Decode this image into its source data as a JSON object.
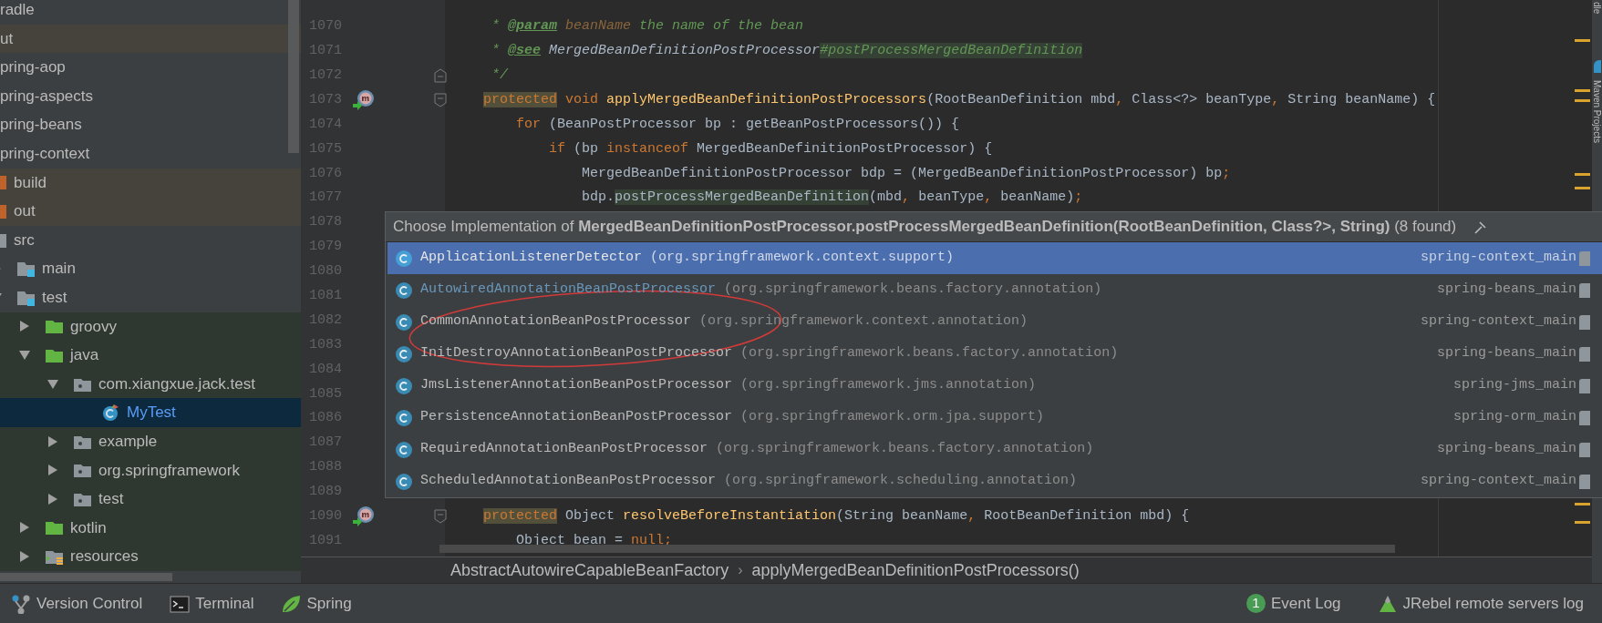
{
  "project_tree": [
    {
      "label": "radle",
      "kind": "module",
      "selected": false
    },
    {
      "label": "ut",
      "kind": "excluded",
      "selected": false
    },
    {
      "label": "pring-aop",
      "kind": "module",
      "selected": false
    },
    {
      "label": "pring-aspects",
      "kind": "module",
      "selected": false
    },
    {
      "label": "pring-beans",
      "kind": "module",
      "selected": false
    },
    {
      "label": "pring-context",
      "kind": "module",
      "selected": false,
      "children": [
        {
          "label": "build",
          "kind": "excluded",
          "selected": false
        },
        {
          "label": "out",
          "kind": "excluded",
          "selected": false
        },
        {
          "label": "src",
          "kind": "folder",
          "selected": false,
          "children": [
            {
              "label": "main",
              "kind": "module-folder",
              "expanded": false,
              "selected": false
            },
            {
              "label": "test",
              "kind": "module-folder",
              "expanded": true,
              "selected": false,
              "children": [
                {
                  "label": "groovy",
                  "kind": "test-source",
                  "expanded": false,
                  "selected": false
                },
                {
                  "label": "java",
                  "kind": "test-source",
                  "expanded": true,
                  "selected": false,
                  "children": [
                    {
                      "label": "com.xiangxue.jack.test",
                      "kind": "package",
                      "expanded": true,
                      "selected": false,
                      "children": [
                        {
                          "label": "MyTest",
                          "kind": "class",
                          "selected": true
                        }
                      ]
                    },
                    {
                      "label": "example",
                      "kind": "package",
                      "expanded": false,
                      "selected": false
                    },
                    {
                      "label": "org.springframework",
                      "kind": "package",
                      "expanded": false,
                      "selected": false
                    },
                    {
                      "label": "test",
                      "kind": "package",
                      "expanded": false,
                      "selected": false
                    }
                  ]
                },
                {
                  "label": "kotlin",
                  "kind": "test-source",
                  "expanded": false,
                  "selected": false
                },
                {
                  "label": "resources",
                  "kind": "test-resources",
                  "expanded": false,
                  "selected": false
                }
              ]
            }
          ]
        }
      ]
    }
  ],
  "editor": {
    "lines": [
      {
        "number": "1070",
        "tokens": [
          {
            "t": "     * ",
            "kind": "doc"
          },
          {
            "t": "@param",
            "kind": "doctag"
          },
          {
            "t": " beanName",
            "kind": "docparam"
          },
          {
            "t": " the name of the bean",
            "kind": "doc"
          }
        ]
      },
      {
        "number": "1071",
        "tokens": [
          {
            "t": "     * ",
            "kind": "doc"
          },
          {
            "t": "@see",
            "kind": "doctag"
          },
          {
            "t": " MergedBeanDefinitionPostProcessor",
            "kind": "docref"
          },
          {
            "t": "#postProcessMergedBeanDefinition",
            "kind": "doc-hl"
          }
        ]
      },
      {
        "number": "1072",
        "kind": "comment-end",
        "tokens": [
          {
            "t": "     */",
            "kind": "doc"
          }
        ]
      },
      {
        "number": "1073",
        "kind": "method-start",
        "tokens": [
          {
            "t": "    protected",
            "kind": "keyword-hl"
          },
          {
            "t": " void ",
            "kind": "keyword"
          },
          {
            "t": "applyMergedBeanDefinitionPostProcessors",
            "kind": "method"
          },
          {
            "t": "(RootBeanDefinition mbd",
            "kind": "plain"
          },
          {
            "t": ", ",
            "kind": "keyword"
          },
          {
            "t": "Class<?> beanType",
            "kind": "plain"
          },
          {
            "t": ", ",
            "kind": "keyword"
          },
          {
            "t": "String beanName) {",
            "kind": "plain"
          }
        ]
      },
      {
        "number": "1074",
        "tokens": [
          {
            "t": "        for ",
            "kind": "keyword"
          },
          {
            "t": "(BeanPostProcessor bp : getBeanPostProcessors()) {",
            "kind": "plain"
          }
        ]
      },
      {
        "number": "1075",
        "tokens": [
          {
            "t": "            if ",
            "kind": "keyword"
          },
          {
            "t": "(bp ",
            "kind": "plain"
          },
          {
            "t": "instanceof ",
            "kind": "keyword"
          },
          {
            "t": "MergedBeanDefinitionPostProcessor) {",
            "kind": "plain"
          }
        ]
      },
      {
        "number": "1076",
        "tokens": [
          {
            "t": "                MergedBeanDefinitionPostProcessor bdp = (MergedBeanDefinitionPostProcessor) bp",
            "kind": "plain"
          },
          {
            "t": ";",
            "kind": "keyword"
          }
        ]
      },
      {
        "number": "1077",
        "tokens": [
          {
            "t": "                bdp.",
            "kind": "plain"
          },
          {
            "t": "postProcessMergedBeanDefinition",
            "kind": "plain-hl"
          },
          {
            "t": "(mbd",
            "kind": "plain"
          },
          {
            "t": ", ",
            "kind": "keyword"
          },
          {
            "t": "beanType",
            "kind": "plain"
          },
          {
            "t": ", ",
            "kind": "keyword"
          },
          {
            "t": "beanName)",
            "kind": "plain"
          },
          {
            "t": ";",
            "kind": "keyword"
          }
        ]
      },
      {
        "number": "1078"
      },
      {
        "number": "1079"
      },
      {
        "number": "1080"
      },
      {
        "number": "1081"
      },
      {
        "number": "1082"
      },
      {
        "number": "1083"
      },
      {
        "number": "1084"
      },
      {
        "number": "1085"
      },
      {
        "number": "1086"
      },
      {
        "number": "1087"
      },
      {
        "number": "1088"
      },
      {
        "number": "1089"
      },
      {
        "number": "1090",
        "kind": "method-start",
        "tokens": [
          {
            "t": "    protected",
            "kind": "keyword-hl"
          },
          {
            "t": " Object ",
            "kind": "plain"
          },
          {
            "t": "resolveBeforeInstantiation",
            "kind": "method"
          },
          {
            "t": "(String beanName",
            "kind": "plain"
          },
          {
            "t": ", ",
            "kind": "keyword"
          },
          {
            "t": "RootBeanDefinition mbd) {",
            "kind": "plain"
          }
        ]
      },
      {
        "number": "1091",
        "tokens": [
          {
            "t": "        Object bean = ",
            "kind": "plain"
          },
          {
            "t": "null",
            "kind": "keyword"
          },
          {
            "t": ";",
            "kind": "keyword"
          }
        ]
      }
    ]
  },
  "breadcrumbs": [
    {
      "label": "AbstractAutowireCapableBeanFactory",
      "kind": "crumb"
    },
    {
      "label": "›",
      "kind": "separator"
    },
    {
      "label": "applyMergedBeanDefinitionPostProcessors()",
      "kind": "crumb"
    }
  ],
  "right_strip": [
    {
      "label": "dle"
    },
    {
      "label": "Maven Projects"
    }
  ],
  "popup": {
    "title": "Choose Implementation of **MergedBeanDefinitionPostProcessor.postProcessMergedBeanDefinition(RootBeanDefinition, Class?>, String)** (8 found)",
    "items": [
      {
        "class": "ApplicationListenerDetector",
        "package": "(org.springframework.context.support)",
        "module": "spring-context_main",
        "color": "#e4e4e4",
        "selected": true
      },
      {
        "class": "AutowiredAnnotationBeanPostProcessor",
        "package": "(org.springframework.beans.factory.annotation)",
        "module": "spring-beans_main",
        "color": "#6897bb",
        "selected": false
      },
      {
        "class": "CommonAnnotationBeanPostProcessor",
        "package": "(org.springframework.context.annotation)",
        "module": "spring-context_main",
        "color": "#bbbbbb",
        "selected": false
      },
      {
        "class": "InitDestroyAnnotationBeanPostProcessor",
        "package": "(org.springframework.beans.factory.annotation)",
        "module": "spring-beans_main",
        "color": "#bbbbbb",
        "selected": false
      },
      {
        "class": "JmsListenerAnnotationBeanPostProcessor",
        "package": "(org.springframework.jms.annotation)",
        "module": "spring-jms_main",
        "color": "#bbbbbb",
        "selected": false
      },
      {
        "class": "PersistenceAnnotationBeanPostProcessor",
        "package": "(org.springframework.orm.jpa.support)",
        "module": "spring-orm_main",
        "color": "#bbbbbb",
        "selected": false
      },
      {
        "class": "RequiredAnnotationBeanPostProcessor",
        "package": "(org.springframework.beans.factory.annotation)",
        "module": "spring-beans_main",
        "color": "#bbbbbb",
        "selected": false
      },
      {
        "class": "ScheduledAnnotationBeanPostProcessor",
        "package": "(org.springframework.scheduling.annotation)",
        "module": "spring-context_main",
        "color": "#bbbbbb",
        "selected": false
      }
    ]
  },
  "tool_bar": {
    "left": [
      {
        "label": "Version Control",
        "kind": "vcs"
      },
      {
        "label": "Terminal",
        "kind": "terminal"
      },
      {
        "label": "Spring",
        "kind": "spring"
      }
    ],
    "right": [
      {
        "label": "Event Log",
        "kind": "event",
        "badge": "1"
      },
      {
        "label": "JRebel remote servers log",
        "kind": "jrebel"
      }
    ]
  }
}
